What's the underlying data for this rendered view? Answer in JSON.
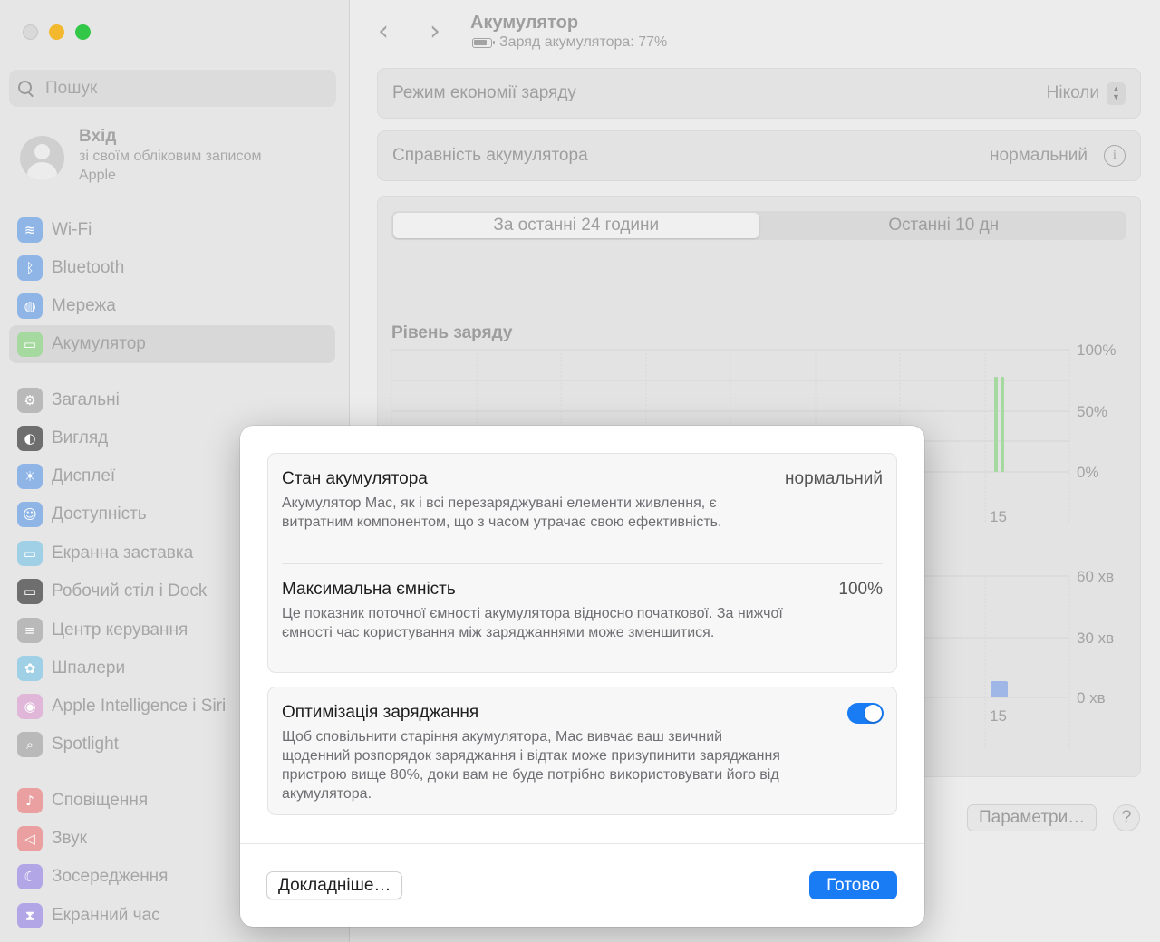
{
  "window": {
    "sidebar": {
      "search_placeholder": "Пошук",
      "account": {
        "title": "Вхід",
        "subtitle": "зі своїм обліковим записом Apple"
      },
      "items": [
        {
          "label": "Wi-Fi",
          "icon": "wifi-icon",
          "color": "#8fb5e6",
          "glyph": "≋"
        },
        {
          "label": "Bluetooth",
          "icon": "bluetooth-icon",
          "color": "#8fb5e6",
          "glyph": "ᛒ"
        },
        {
          "label": "Мережа",
          "icon": "globe-icon",
          "color": "#8fb5e6",
          "glyph": "◍"
        },
        {
          "label": "Акумулятор",
          "icon": "battery-icon",
          "color": "#a6d9a0",
          "glyph": "▭"
        },
        {
          "label": "Загальні",
          "icon": "gear-icon",
          "color": "#b9b9b9",
          "glyph": "⚙"
        },
        {
          "label": "Вигляд",
          "icon": "appearance-icon",
          "color": "#6e6e6e",
          "glyph": "◐"
        },
        {
          "label": "Дисплеї",
          "icon": "sun-icon",
          "color": "#8fb5e6",
          "glyph": "☀"
        },
        {
          "label": "Доступність",
          "icon": "accessibility-icon",
          "color": "#8fb5e6",
          "glyph": "☺"
        },
        {
          "label": "Екранна заставка",
          "icon": "screensaver-icon",
          "color": "#9fd0e6",
          "glyph": "▭"
        },
        {
          "label": "Робочий стіл і Dock",
          "icon": "dock-icon",
          "color": "#6e6e6e",
          "glyph": "▭"
        },
        {
          "label": "Центр керування",
          "icon": "control-center-icon",
          "color": "#b9b9b9",
          "glyph": "≡"
        },
        {
          "label": "Шпалери",
          "icon": "wallpaper-icon",
          "color": "#9fd0e6",
          "glyph": "✿"
        },
        {
          "label": "Apple Intelligence і Siri",
          "icon": "siri-icon",
          "color": "#e0b7d9",
          "glyph": "◉"
        },
        {
          "label": "Spotlight",
          "icon": "spotlight-icon",
          "color": "#b9b9b9",
          "glyph": "⌕"
        },
        {
          "label": "Сповіщення",
          "icon": "bell-icon",
          "color": "#eaa0a0",
          "glyph": "♪"
        },
        {
          "label": "Звук",
          "icon": "speaker-icon",
          "color": "#eaa0a0",
          "glyph": "◁"
        },
        {
          "label": "Зосередження",
          "icon": "moon-icon",
          "color": "#b2a6e6",
          "glyph": "☾"
        },
        {
          "label": "Екранний час",
          "icon": "hourglass-icon",
          "color": "#b2a6e6",
          "glyph": "⧗"
        }
      ]
    },
    "header": {
      "title": "Акумулятор",
      "subtitle": "Заряд акумулятора: 77%"
    },
    "rows": {
      "low_power_label": "Режим економії заряду",
      "low_power_value": "Ніколи",
      "health_label": "Справність акумулятора",
      "health_value": "нормальний"
    },
    "tabs": [
      "За останні 24 години",
      "Останні 10 дн"
    ],
    "chart_title": "Рівень заряду",
    "buttons": {
      "params": "Параметри…",
      "help": "?"
    }
  },
  "chart_data": [
    {
      "type": "bar",
      "title": "Рівень заряду",
      "y_ticks": [
        "100%",
        "50%",
        "0%"
      ],
      "ylim": [
        0,
        100
      ],
      "x_tick_labels": [
        "15"
      ]
    },
    {
      "type": "bar",
      "y_ticks": [
        "60 хв",
        "30 хв",
        "0 хв"
      ],
      "x_tick_labels": [
        "15"
      ]
    }
  ],
  "modal": {
    "status_title": "Стан акумулятора",
    "status_value": "нормальний",
    "status_desc": "Акумулятор Mac, як і всі перезаряджувані елементи живлення, є витратним компонентом, що з часом утрачає свою ефективність.",
    "capacity_title": "Максимальна ємність",
    "capacity_value": "100%",
    "capacity_desc": "Це показник поточної ємності акумулятора відносно початкової. За нижчої ємності час користування між заряджаннями може зменшитися.",
    "optimize_title": "Оптимізація заряджання",
    "optimize_enabled": true,
    "optimize_desc": "Щоб сповільнити старіння акумулятора, Mac вивчає ваш звичний щоденний розпорядок заряджання і відтак може призупинити заряджання пристрою вище 80%, доки вам не буде потрібно використовувати його від акумулятора.",
    "more_button": "Докладніше…",
    "done_button": "Готово",
    "accent": "#1a7cf4"
  }
}
